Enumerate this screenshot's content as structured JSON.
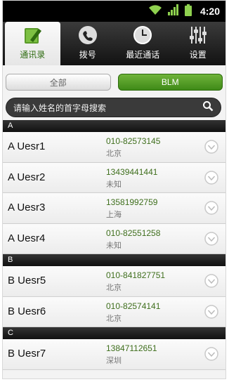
{
  "status": {
    "time": "4:20",
    "icons": [
      "wifi-icon",
      "signal-icon",
      "battery-icon"
    ]
  },
  "tabs": [
    {
      "label": "通讯录",
      "icon": "contacts-book-icon",
      "active": true
    },
    {
      "label": "拨号",
      "icon": "phone-handset-icon",
      "active": false
    },
    {
      "label": "最近通话",
      "icon": "clock-icon",
      "active": false
    },
    {
      "label": "设置",
      "icon": "sliders-icon",
      "active": false
    }
  ],
  "filter": {
    "all_label": "全部",
    "blm_label": "BLM",
    "selected": "BLM"
  },
  "search": {
    "placeholder": "请输入姓名的首字母搜索",
    "icon": "search-icon"
  },
  "sections": [
    {
      "letter": "A",
      "contacts": [
        {
          "name": "A Uesr1",
          "phone": "010-82573145",
          "location": "北京"
        },
        {
          "name": "A Uesr2",
          "phone": "13439441441",
          "location": "未知"
        },
        {
          "name": "A Uesr3",
          "phone": "13581992759",
          "location": "上海"
        },
        {
          "name": "A Uesr4",
          "phone": "010-82551258",
          "location": "未知"
        }
      ]
    },
    {
      "letter": "B",
      "contacts": [
        {
          "name": "B Uesr5",
          "phone": "010-841827751",
          "location": "北京"
        },
        {
          "name": "B Uesr6",
          "phone": "010-82574141",
          "location": "北京"
        }
      ]
    },
    {
      "letter": "C",
      "contacts": [
        {
          "name": "B Uesr7",
          "phone": "13847112651",
          "location": "深圳"
        }
      ]
    }
  ],
  "colors": {
    "accent_green": "#3f8a18",
    "phone_text": "#3e6e1c"
  }
}
